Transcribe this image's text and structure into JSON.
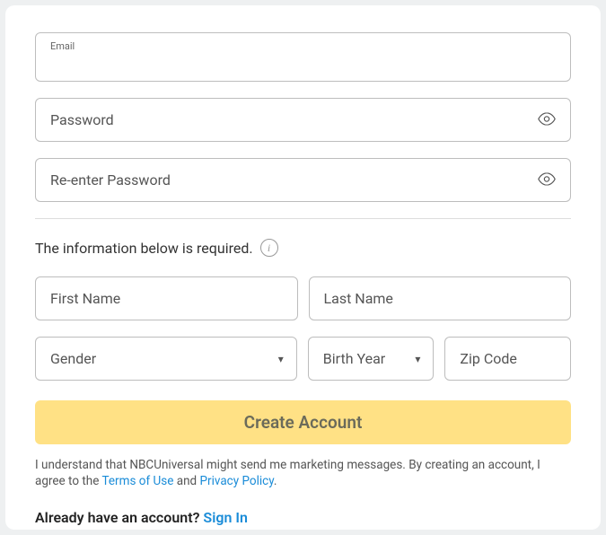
{
  "email": {
    "label": "Email",
    "value": ""
  },
  "password": {
    "placeholder": "Password",
    "value": ""
  },
  "reenter": {
    "placeholder": "Re-enter Password",
    "value": ""
  },
  "info_text": "The information below is required.",
  "first_name": {
    "placeholder": "First Name",
    "value": ""
  },
  "last_name": {
    "placeholder": "Last Name",
    "value": ""
  },
  "gender": {
    "placeholder": "Gender",
    "value": ""
  },
  "birth_year": {
    "placeholder": "Birth Year",
    "value": ""
  },
  "zip": {
    "placeholder": "Zip Code",
    "value": ""
  },
  "create_label": "Create Account",
  "legal": {
    "pre": "I understand that NBCUniversal might send me marketing messages. By creating an account, I agree to the ",
    "terms": "Terms of Use",
    "and": " and ",
    "privacy": "Privacy Policy",
    "period": "."
  },
  "signin": {
    "prompt": "Already have an account? ",
    "link": "Sign In"
  }
}
